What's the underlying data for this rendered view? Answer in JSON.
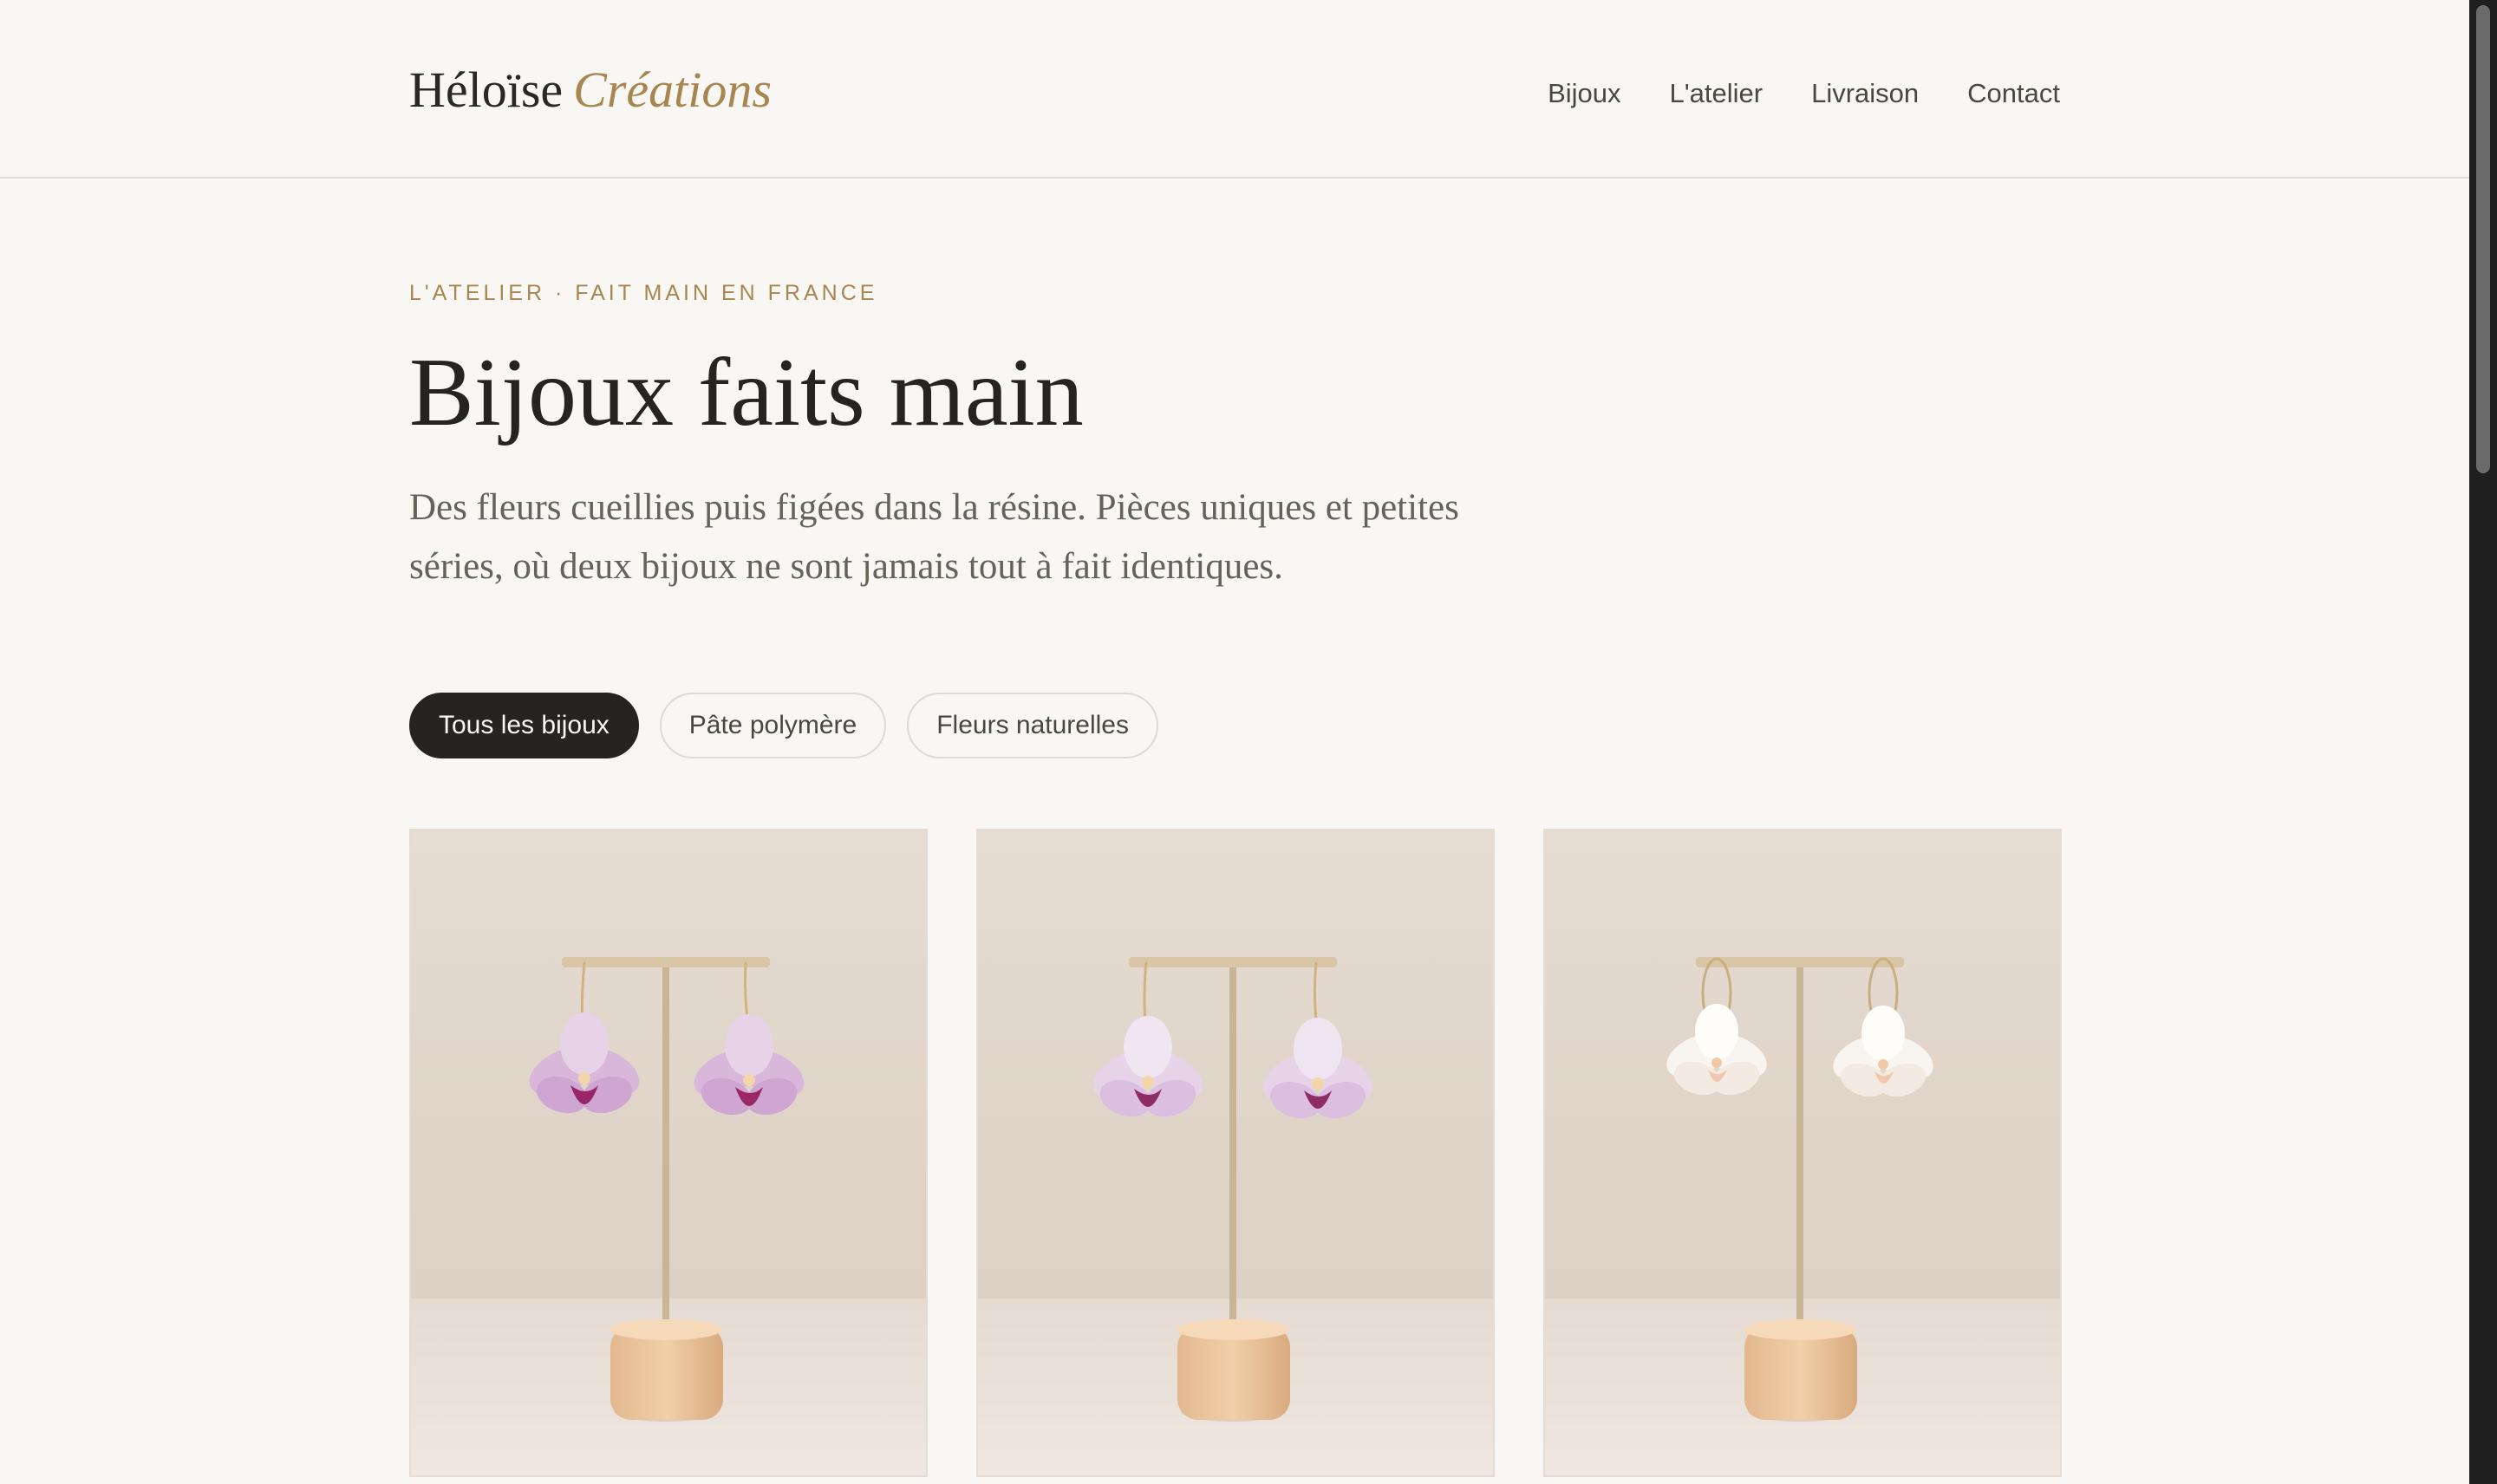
{
  "brand": {
    "name": "Héloïse",
    "accent": "Créations"
  },
  "nav": {
    "items": [
      {
        "label": "Bijoux"
      },
      {
        "label": "L'atelier"
      },
      {
        "label": "Livraison"
      },
      {
        "label": "Contact"
      }
    ]
  },
  "hero": {
    "eyebrow": "L'ATELIER · FAIT MAIN EN FRANCE",
    "title": "Bijoux faits main",
    "description": "Des fleurs cueillies puis figées dans la résine. Pièces uniques et petites séries, où deux bijoux ne sont jamais tout à fait identiques."
  },
  "filters": {
    "items": [
      {
        "label": "Tous les bijoux",
        "active": true
      },
      {
        "label": "Pâte polymère",
        "active": false
      },
      {
        "label": "Fleurs naturelles",
        "active": false
      }
    ]
  },
  "products": [
    {
      "image": "orchid-earrings-purple-photo",
      "flower_color": "#d8b7da",
      "lip_color": "#9a2567"
    },
    {
      "image": "orchid-earrings-lilac-photo",
      "flower_color": "#e7d3e8",
      "lip_color": "#8d2c67"
    },
    {
      "image": "orchid-earrings-white-photo",
      "flower_color": "#f8f4ef",
      "lip_color": "#f0c7b0"
    }
  ],
  "colors": {
    "background": "#f8f7f3",
    "text": "#262421",
    "accent": "#a8864f",
    "muted": "#66625b",
    "photo_background": "#e6dcd2"
  }
}
